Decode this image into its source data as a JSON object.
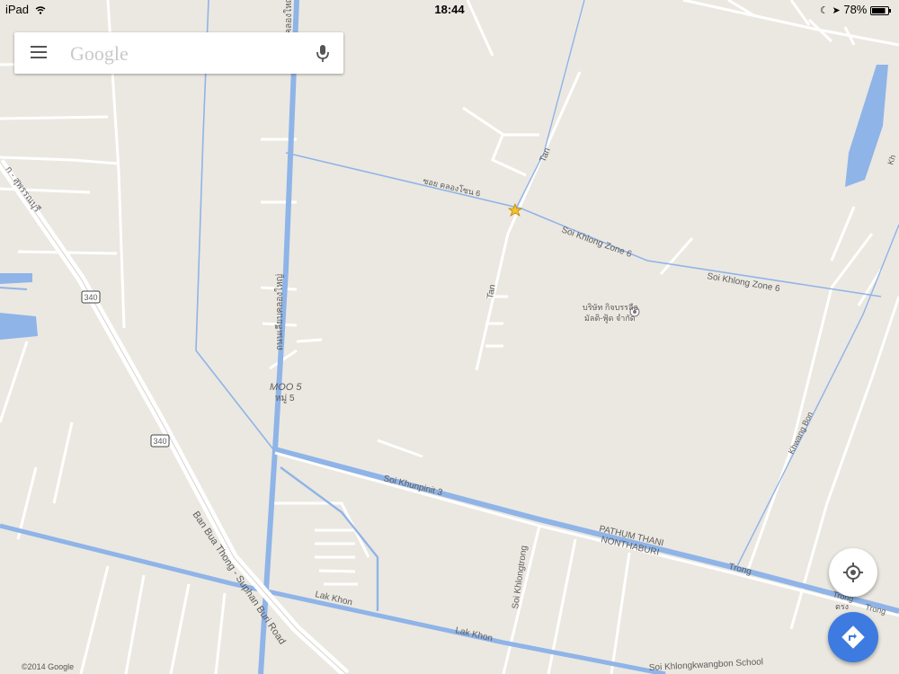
{
  "status_bar": {
    "device": "iPad",
    "time": "18:44",
    "battery": "78%",
    "icons": [
      "wifi-icon",
      "moon-icon",
      "location-arrow-icon",
      "battery-icon"
    ]
  },
  "search": {
    "placeholder": "Google",
    "icons": [
      "menu-icon",
      "microphone-icon"
    ]
  },
  "map_labels": {
    "soi_khlong_zone6_thai": "ซอย คลองโซน 6",
    "soi_khlong_zone6_a": "Soi Khlong Zone 6",
    "soi_khlong_zone6_b": "Soi Khlong Zone 6",
    "tan_north": "Tan",
    "tan_south": "Tan",
    "road_thai_1": "ถนนเลียบคลองใหญ่",
    "road_thai_2": "ถนนเลียบคลองใหญ่",
    "road_thai_left": "ก - สุพรรณบุรี",
    "company_line1": "บริษัท กิจบรรลือ",
    "company_line2": "มัลติ-ฟู้ด จำกัด",
    "moo5": "MOO 5",
    "moo5_thai": "หมู่ 5",
    "shield_340_a": "340",
    "shield_340_b": "340",
    "soi_khunpinit": "Soi Khunpinit 3",
    "pathum_thani": "PATHUM THANI",
    "nonthaburi": "NONTHABURI",
    "khwang_bon": "Khwang Bon",
    "trong_1": "Trong",
    "trong_2": "Trong",
    "trong_thai": "ตรง",
    "trong_3": "Trong",
    "suphan_road": "Ban Bua Thong - Suphan Buri Road",
    "lak_khon_1": "Lak Khon",
    "lak_khon_2": "Lak Khon",
    "soi_khlongtrong": "Soi Khlongtrong",
    "soi_khlongkwangbon": "Soi Khlongkwangbon School",
    "kh_edge": "Kh"
  },
  "controls": {
    "my_location_icon": "crosshair-icon",
    "directions_icon": "directions-icon"
  },
  "copyright": "©2014 Google",
  "colors": {
    "land": "#ebe8e1",
    "water": "#8fb4e8",
    "road": "#ffffff",
    "accent": "#3e7be0"
  }
}
